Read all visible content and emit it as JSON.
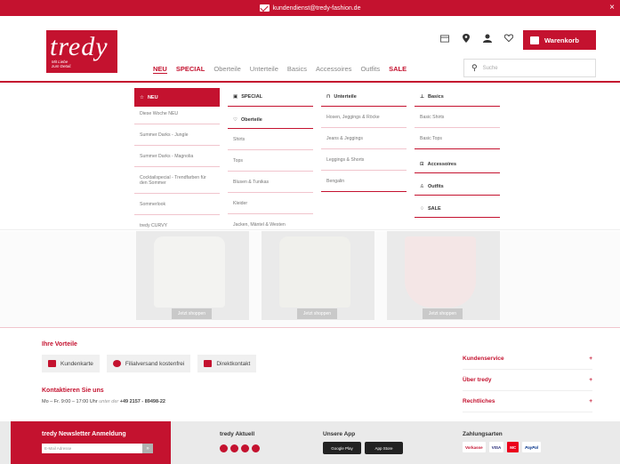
{
  "topbar": {
    "email": "kundendienst@tredy-fashion.de",
    "close": "×"
  },
  "logo": {
    "word": "tredy",
    "tag_line1": "Mit Liebe",
    "tag_line2": "zum Detail."
  },
  "header": {
    "cart_label": "Warenkorb",
    "search_placeholder": "Suche"
  },
  "nav": [
    "NEU",
    "SPECIAL",
    "Oberteile",
    "Unterteile",
    "Basics",
    "Accessoires",
    "Outfits",
    "SALE"
  ],
  "mega": {
    "neu": {
      "title": "NEU",
      "items": [
        "Diese Woche NEU",
        "Summer Darks - Jungle",
        "Summer Darks - Magnolia",
        "Cocktailspecial - Trendfarben für den Sommer",
        "Sommerlook",
        "tredy CURVY"
      ]
    },
    "special": {
      "title": "SPECIAL"
    },
    "oberteile": {
      "title": "Oberteile",
      "items": [
        "Shirts",
        "Tops",
        "Blusen & Tunikas",
        "Kleider",
        "Jacken, Mäntel & Westen"
      ]
    },
    "unterteile": {
      "title": "Unterteile",
      "items": [
        "Hosen, Jeggings & Röcke",
        "Jeans & Jeggings",
        "Leggings & Shorts",
        "Bengalin"
      ]
    },
    "basics": {
      "title": "Basics",
      "items": [
        "Basic Shirts",
        "Basic Tops"
      ]
    },
    "accessoires": {
      "title": "Accessoires"
    },
    "outfits": {
      "title": "Outfits"
    },
    "sale": {
      "title": "SALE"
    }
  },
  "products": [
    {
      "button": "Jetzt shoppen"
    },
    {
      "button": "Jetzt shoppen"
    },
    {
      "button": "Jetzt shoppen"
    }
  ],
  "advantages": {
    "title": "Ihre Vorteile",
    "items": [
      "Kundenkarte",
      "Filialversand kostenfrei",
      "Direktkontakt"
    ]
  },
  "contact": {
    "title": "Kontaktieren Sie uns",
    "hours": "Mo – Fr. 9:00 – 17:00 Uhr",
    "under": "unter der",
    "phone": "+49 2157 - 89498-22"
  },
  "footer_links": [
    {
      "label": "Kundenservice",
      "sign": "+"
    },
    {
      "label": "Über tredy",
      "sign": "+"
    },
    {
      "label": "Rechtliches",
      "sign": "+"
    }
  ],
  "footer": {
    "newsletter_title": "tredy Newsletter Anmeldung",
    "newsletter_placeholder": "E-Mail Adresse",
    "newsletter_go": "»",
    "aktuell_title": "tredy Aktuell",
    "app_title": "Unsere App",
    "apps": [
      "Google Play",
      "App Store"
    ],
    "payment_title": "Zahlungsarten",
    "payments": [
      "Vorkasse",
      "VISA",
      "MC",
      "PayPal"
    ]
  }
}
